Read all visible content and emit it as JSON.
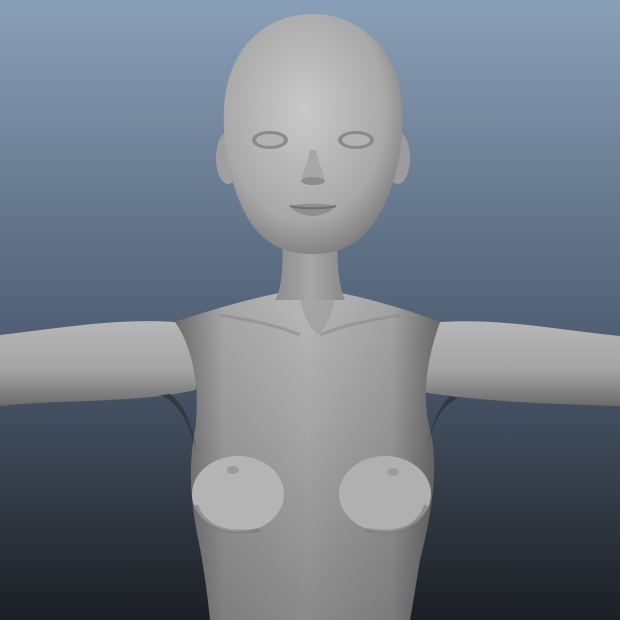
{
  "viewport": {
    "background_top": "#8aa0b8",
    "background_mid": "#4f5e72",
    "background_bottom": "#1c1f24"
  },
  "model": {
    "shading_light": "#c4c4c4",
    "shading_mid": "#9a9a9a",
    "shading_dark": "#3a3a3a"
  }
}
